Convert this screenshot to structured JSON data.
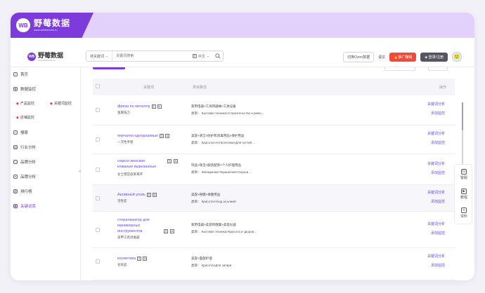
{
  "app": {
    "brand_title": "野莓数据",
    "brand_url": "www.wildberrian.ru",
    "logo_mark": "WB"
  },
  "header": {
    "logo_title": "野莓数据",
    "logo_url": "www.wildberrian.ru",
    "search_select": "搜关键词",
    "search_placeholder": "关键词搜索",
    "lang": "中文",
    "switch_ozon": "切换Ozon数据",
    "language": "语言",
    "promo": "推广赚钱",
    "vip": "登录/注册"
  },
  "sidebar": {
    "items": [
      {
        "label": "首页",
        "icon": "home-icon"
      },
      {
        "label": "数据监控",
        "icon": "eye-icon"
      },
      {
        "label": "搜索",
        "icon": "search-icon"
      },
      {
        "label": "行业分析",
        "icon": "industry-icon"
      },
      {
        "label": "品牌分析",
        "icon": "brand-icon"
      },
      {
        "label": "品牌分析",
        "icon": "shop-icon"
      },
      {
        "label": "排行榜",
        "icon": "ranking-icon"
      },
      {
        "label": "关键词库",
        "icon": "keyword-icon"
      }
    ],
    "sub_items": [
      {
        "label": "产品监控"
      },
      {
        "label": "关键词监控"
      },
      {
        "label": "店铺监控"
      }
    ]
  },
  "table": {
    "col_keyword": "关键词",
    "col_category": "类目路径",
    "col_action": "操作",
    "rows": [
      {
        "keyword": "фреза по металлу",
        "sub": "金属铣刀",
        "category": "家用电器>工具和器械>工具设备",
        "category2": "类目： Бытовая техника>Строительство и ремо...",
        "action1": "关键词分析",
        "action2": "添加监控"
      },
      {
        "keyword": "перчатки одноразовые",
        "sub": "一次性手套",
        "category": "美容>清洁>防护和消毒用品>保护用品",
        "category2": "类目： Красота>Антисептики>Для ногтей ...",
        "action1": "关键词分析",
        "action2": "添加监控"
      },
      {
        "keyword": "серьги женские кожаные вырезанные",
        "sub": "女士镂空皮革耳环",
        "category": "饰品>珠宝>服装配饰>个人护理用品",
        "category2": "类目： Женщинам>Украшения>Серьги ...",
        "action1": "关键词分析",
        "action2": "添加监控"
      },
      {
        "keyword": "Активный уголь",
        "sub": "活性炭",
        "category": "美容>保健>保健用品",
        "category2": "类目： Красота>Уход за кожей",
        "action1": "关键词分析",
        "action2": "添加监控"
      },
      {
        "keyword": "стерилизатор для маникюрных инструментов",
        "sub": "美甲工具消毒器",
        "category": "家用电器>美容和健康>美容仪器",
        "category2": "类目： Бытовая техника>Красота и здоров...",
        "action1": "关键词分析",
        "action2": "添加监控"
      },
      {
        "keyword": "косметика",
        "sub": "化妆品",
        "category": "美容>面部护理",
        "category2": "类目： Красота>Для загара",
        "action1": "关键词分析",
        "action2": "添加监控"
      }
    ]
  },
  "float": {
    "service": "客服",
    "tutorial": "教程",
    "docs": "资料"
  }
}
